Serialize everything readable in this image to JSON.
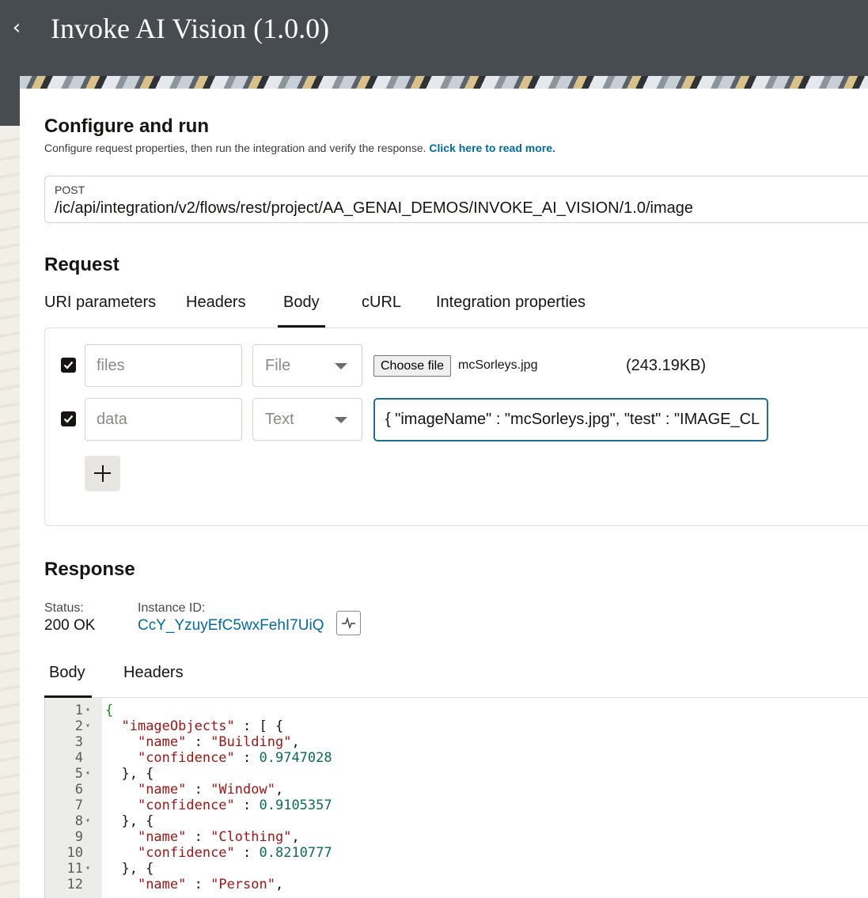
{
  "header": {
    "title": "Invoke AI Vision (1.0.0)"
  },
  "configure": {
    "title": "Configure and run",
    "subtitle": "Configure request properties, then run the integration and verify the response.",
    "read_more": "Click here to read more."
  },
  "endpoint": {
    "method": "POST",
    "path": "/ic/api/integration/v2/flows/rest/project/AA_GENAI_DEMOS/INVOKE_AI_VISION/1.0/image"
  },
  "request": {
    "title": "Request",
    "tabs": [
      "URI parameters",
      "Headers",
      "Body",
      "cURL",
      "Integration properties"
    ],
    "active_tab": "Body",
    "rows": [
      {
        "checked": true,
        "name_placeholder": "files",
        "type": "File",
        "choose_label": "Choose file",
        "file_name": "mcSorleys.jpg",
        "file_size": "(243.19KB)"
      },
      {
        "checked": true,
        "name_placeholder": "data",
        "type": "Text",
        "value": "{ \"imageName\" : \"mcSorleys.jpg\", \"test\" : \"IMAGE_CL"
      }
    ]
  },
  "response": {
    "title": "Response",
    "status_label": "Status:",
    "status_value": "200 OK",
    "instance_label": "Instance ID:",
    "instance_value": "CcY_YzuyEfC5wxFehI7UiQ",
    "tabs": [
      "Body",
      "Headers"
    ],
    "active_tab": "Body",
    "code_lines": [
      {
        "n": "1",
        "fold": true
      },
      {
        "n": "2",
        "fold": true
      },
      {
        "n": "3",
        "fold": false
      },
      {
        "n": "4",
        "fold": false
      },
      {
        "n": "5",
        "fold": true
      },
      {
        "n": "6",
        "fold": false
      },
      {
        "n": "7",
        "fold": false
      },
      {
        "n": "8",
        "fold": true
      },
      {
        "n": "9",
        "fold": false
      },
      {
        "n": "10",
        "fold": false
      },
      {
        "n": "11",
        "fold": true
      },
      {
        "n": "12",
        "fold": false
      }
    ],
    "json": {
      "open": "{",
      "key_imageObjects": "\"imageObjects\"",
      "after_imageObjects": " : [ {",
      "objects": [
        {
          "name": "\"Building\"",
          "confidence": "0.9747028"
        },
        {
          "name": "\"Window\"",
          "confidence": "0.9105357"
        },
        {
          "name": "\"Clothing\"",
          "confidence": "0.8210777"
        },
        {
          "name": "\"Person\""
        }
      ],
      "key_name": "\"name\"",
      "key_confidence": "\"confidence\"",
      "sep": " : ",
      "comma": ",",
      "close_open": "}, {"
    }
  }
}
